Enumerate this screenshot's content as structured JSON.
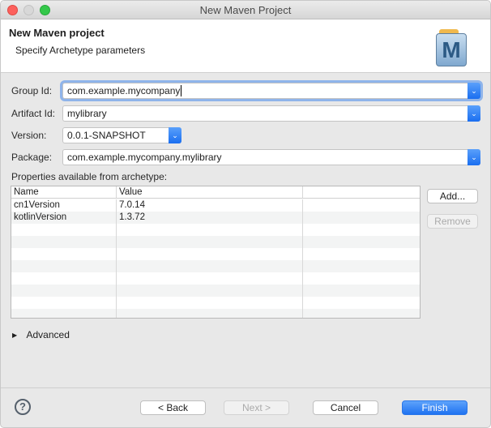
{
  "window": {
    "title": "New Maven Project"
  },
  "header": {
    "title": "New Maven project",
    "subtitle": "Specify Archetype parameters",
    "logo_text": "M"
  },
  "form": {
    "group_id": {
      "label": "Group Id:",
      "value": "com.example.mycompany"
    },
    "artifact_id": {
      "label": "Artifact Id:",
      "value": "mylibrary"
    },
    "version": {
      "label": "Version:",
      "value": "0.0.1-SNAPSHOT"
    },
    "package": {
      "label": "Package:",
      "value": "com.example.mycompany.mylibrary"
    }
  },
  "properties": {
    "label": "Properties available from archetype:",
    "columns": [
      "Name",
      "Value",
      ""
    ],
    "rows": [
      {
        "name": "cn1Version",
        "value": "7.0.14"
      },
      {
        "name": "kotlinVersion",
        "value": "1.3.72"
      }
    ],
    "add_label": "Add...",
    "remove_label": "Remove"
  },
  "advanced": {
    "label": "Advanced"
  },
  "footer": {
    "back": "< Back",
    "next": "Next >",
    "cancel": "Cancel",
    "finish": "Finish",
    "help": "?"
  },
  "colors": {
    "accent": "#1f72f1",
    "focus": "#8fb4ea"
  }
}
